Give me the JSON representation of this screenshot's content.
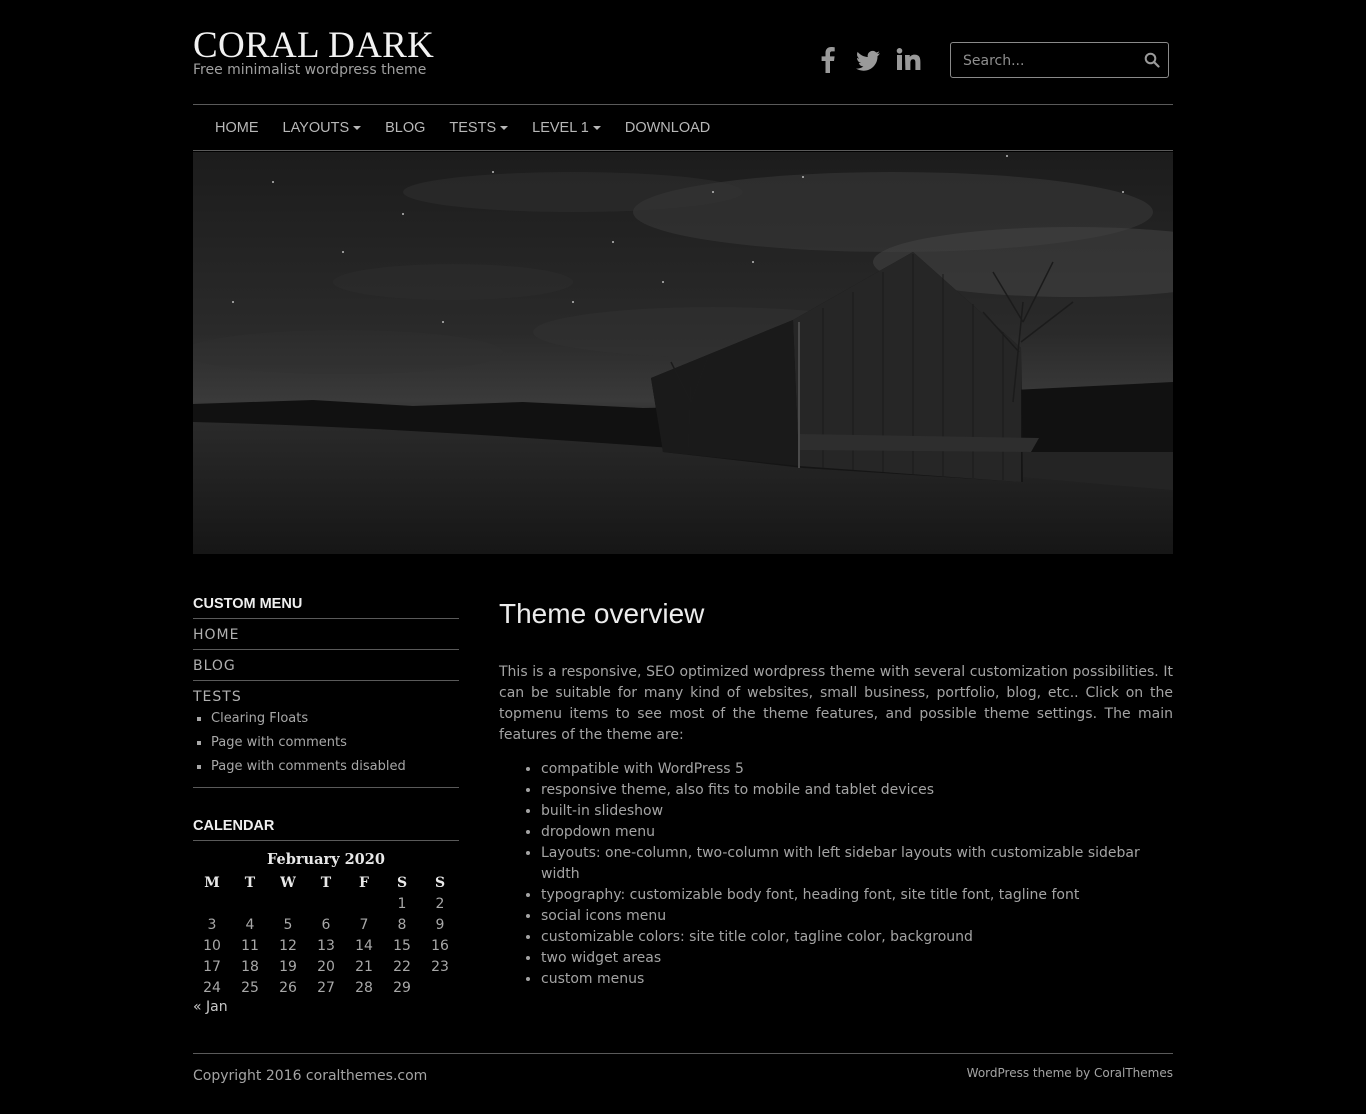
{
  "header": {
    "title": "CORAL DARK",
    "tagline": "Free minimalist wordpress theme",
    "social_icons": [
      "facebook-icon",
      "twitter-icon",
      "linkedin-icon"
    ],
    "search_placeholder": "Search..."
  },
  "nav": {
    "items": [
      {
        "label": "HOME",
        "dropdown": false
      },
      {
        "label": "LAYOUTS",
        "dropdown": true
      },
      {
        "label": "BLOG",
        "dropdown": false
      },
      {
        "label": "TESTS",
        "dropdown": true
      },
      {
        "label": "LEVEL 1",
        "dropdown": true
      },
      {
        "label": "DOWNLOAD",
        "dropdown": false
      }
    ]
  },
  "sidebar": {
    "custom_menu": {
      "title": "CUSTOM MENU",
      "items": [
        "HOME",
        "BLOG",
        "TESTS"
      ],
      "subitems": [
        "Clearing Floats",
        "Page with comments",
        "Page with comments disabled"
      ]
    },
    "calendar": {
      "title": "CALENDAR",
      "caption": "February 2020",
      "weekdays": [
        "M",
        "T",
        "W",
        "T",
        "F",
        "S",
        "S"
      ],
      "weeks": [
        [
          "",
          "",
          "",
          "",
          "",
          "1",
          "2"
        ],
        [
          "3",
          "4",
          "5",
          "6",
          "7",
          "8",
          "9"
        ],
        [
          "10",
          "11",
          "12",
          "13",
          "14",
          "15",
          "16"
        ],
        [
          "17",
          "18",
          "19",
          "20",
          "21",
          "22",
          "23"
        ],
        [
          "24",
          "25",
          "26",
          "27",
          "28",
          "29",
          ""
        ]
      ],
      "prev": "« Jan"
    }
  },
  "main": {
    "title": "Theme overview",
    "intro": "This is a responsive, SEO optimized wordpress theme with several customization possibilities. It can be suitable for many kind of websites, small business, portfolio, blog, etc.. Click on the topmenu items to see most of the theme features, and possible theme settings. The main features of the theme are:",
    "features": [
      "compatible with WordPress 5",
      "responsive theme, also fits to mobile and tablet devices",
      "built-in slideshow",
      "dropdown menu",
      "Layouts: one-column, two-column with left sidebar layouts with customizable sidebar width",
      "typography: customizable body font, heading font, site title font, tagline font",
      "social icons menu",
      "customizable colors: site title color, tagline color, background",
      "two widget areas",
      "custom menus"
    ]
  },
  "footer": {
    "copyright": "Copyright 2016 coralthemes.com",
    "credit": "WordPress theme by CoralThemes"
  },
  "colors": {
    "background": "#000000",
    "title": "#f2f2f2",
    "text": "#a8a8a8",
    "border": "#5a5a5a"
  }
}
